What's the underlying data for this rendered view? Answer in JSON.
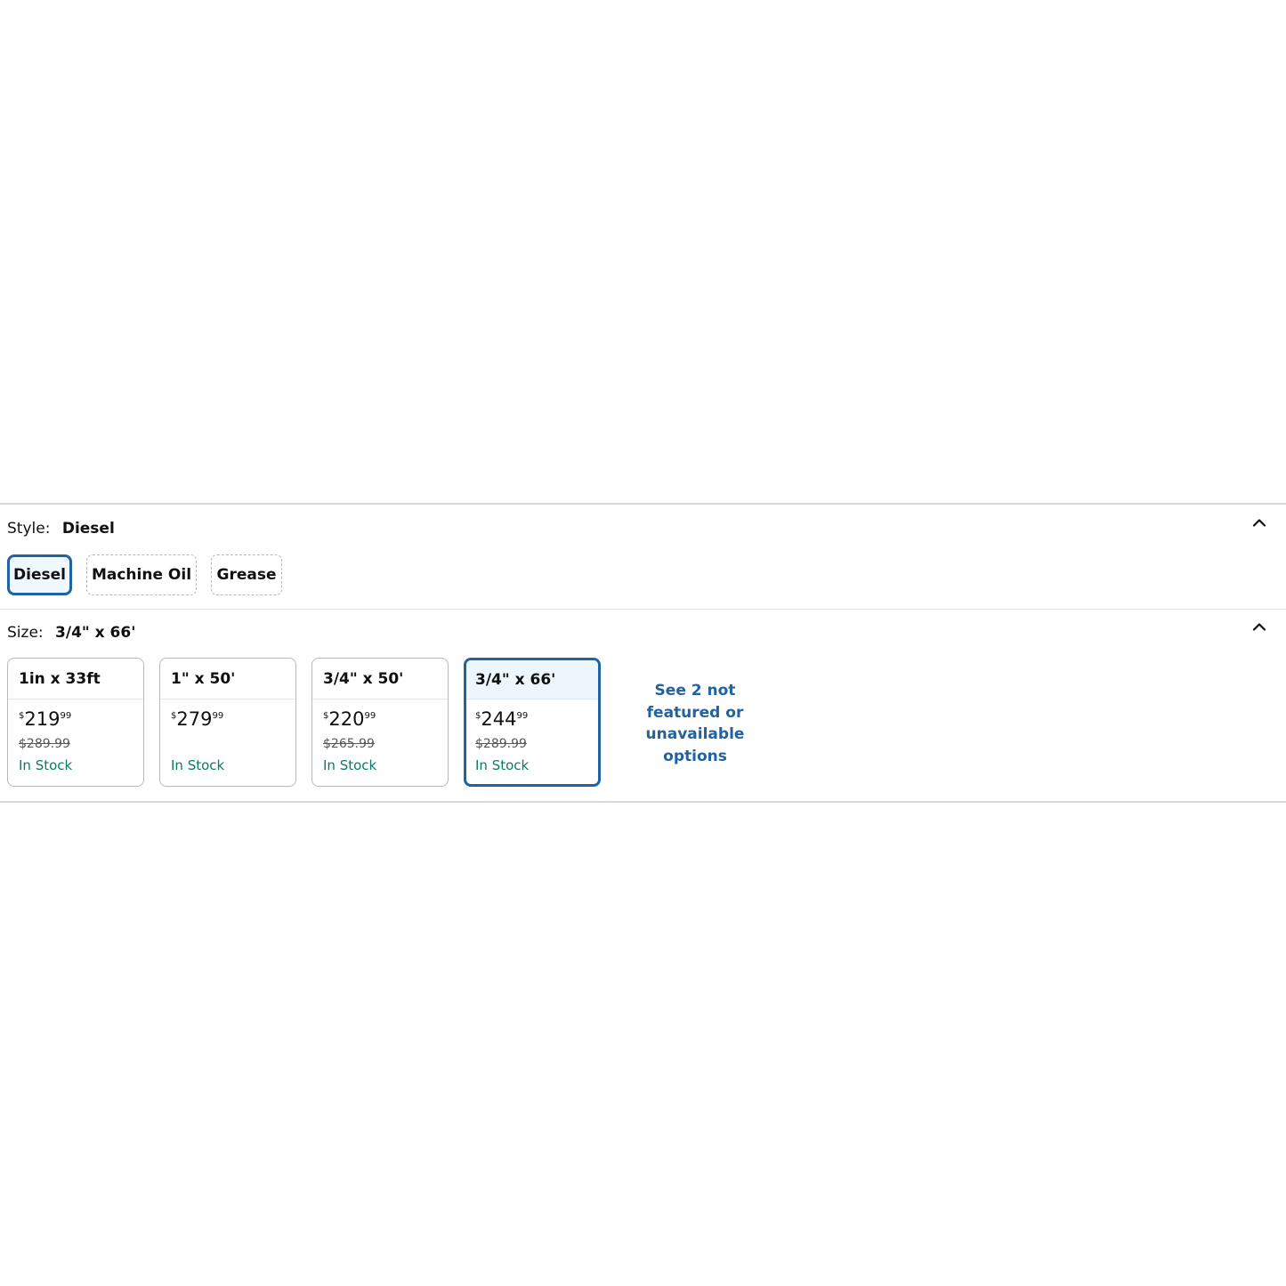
{
  "style": {
    "label": "Style:",
    "selected_value": "Diesel",
    "options": [
      {
        "label": "Diesel",
        "selected": true
      },
      {
        "label": "Machine Oil",
        "selected": false
      },
      {
        "label": "Grease",
        "selected": false
      }
    ],
    "collapse_icon": "chevron-up-icon"
  },
  "size": {
    "label": "Size:",
    "selected_value": "3/4\" x 66'",
    "collapse_icon": "chevron-up-icon",
    "options": [
      {
        "label": "1in x 33ft",
        "currency": "$",
        "price_whole": "219",
        "price_fraction": "99",
        "list_price": "$289.99",
        "availability": "In Stock",
        "selected": false
      },
      {
        "label": "1\" x 50'",
        "currency": "$",
        "price_whole": "279",
        "price_fraction": "99",
        "list_price": "",
        "availability": "In Stock",
        "selected": false
      },
      {
        "label": "3/4\" x 50'",
        "currency": "$",
        "price_whole": "220",
        "price_fraction": "99",
        "list_price": "$265.99",
        "availability": "In Stock",
        "selected": false
      },
      {
        "label": "3/4\" x 66'",
        "currency": "$",
        "price_whole": "244",
        "price_fraction": "99",
        "list_price": "$289.99",
        "availability": "In Stock",
        "selected": true
      }
    ],
    "see_more_link": "See 2 not featured or unavailable options"
  },
  "colors": {
    "selected_border": "#2162a1",
    "in_stock": "#067d62",
    "link": "#2162a1",
    "divider": "#d5d9d9"
  }
}
